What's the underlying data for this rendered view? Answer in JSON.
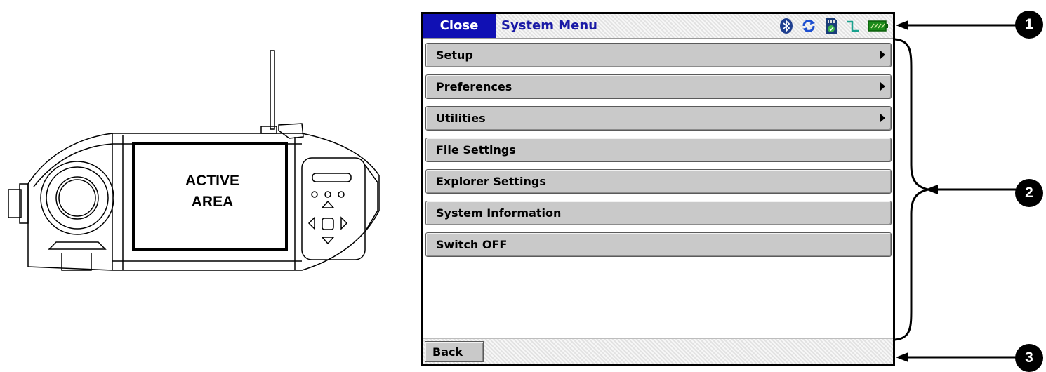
{
  "device": {
    "active_area_line1": "ACTIVE",
    "active_area_line2": "AREA"
  },
  "screen": {
    "close_label": "Close",
    "title": "System Menu",
    "status_icons": [
      "bluetooth-icon",
      "sync-icon",
      "sd-card-icon",
      "signal-icon",
      "battery-icon"
    ],
    "menu_items": [
      {
        "label": "Setup",
        "has_submenu": true
      },
      {
        "label": "Preferences",
        "has_submenu": true
      },
      {
        "label": "Utilities",
        "has_submenu": true
      },
      {
        "label": "File Settings",
        "has_submenu": false
      },
      {
        "label": "Explorer Settings",
        "has_submenu": false
      },
      {
        "label": "System Information",
        "has_submenu": false
      },
      {
        "label": "Switch OFF",
        "has_submenu": false
      }
    ],
    "back_label": "Back"
  },
  "callouts": [
    "1",
    "2",
    "3"
  ],
  "colors": {
    "title_bar_accent": "#1010b4",
    "title_text": "#1a1aa6",
    "menu_item_bg": "#c9c9c9"
  }
}
